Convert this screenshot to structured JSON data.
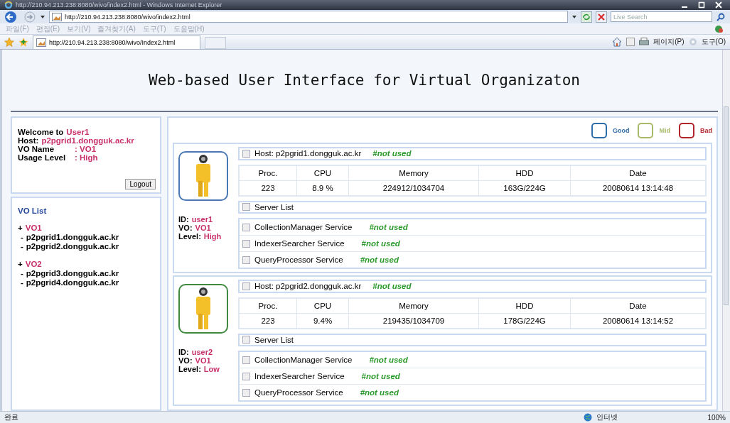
{
  "window": {
    "title": "http://210.94.213.238:8080/wivo/index2.html - Windows Internet Explorer"
  },
  "address_bar": {
    "url": "http://210.94.213.238:8080/wivo/index2.html",
    "search_placeholder": "Live Search"
  },
  "menu": [
    "파일(F)",
    "편집(E)",
    "보기(V)",
    "즐겨찾기(A)",
    "도구(T)",
    "도움말(H)"
  ],
  "tab": {
    "label": "http://210.94.213.238:8080/wivo/Index2.html"
  },
  "command_bar": [
    "페이지(P)",
    "도구(O)"
  ],
  "page": {
    "heading": "Web-based User Interface for Virtual Organizaton",
    "user_panel": {
      "rows": [
        {
          "label": "Welcome to",
          "value": "User1"
        },
        {
          "label": "Host:",
          "value": "p2pgrid1.dongguk.ac.kr"
        },
        {
          "label": "VO Name",
          "value": ": VO1"
        },
        {
          "label": "Usage Level",
          "value": ": High"
        }
      ],
      "logout": "Logout"
    },
    "vo_list": {
      "title": "VO List",
      "groups": [
        {
          "marker": "+",
          "name": "VO1",
          "children": [
            {
              "marker": "-",
              "label": "p2pgrid1.dongguk.ac.kr"
            },
            {
              "marker": "-",
              "label": "p2pgrid2.dongguk.ac.kr"
            }
          ]
        },
        {
          "marker": "+",
          "name": "VO2",
          "children": [
            {
              "marker": "-",
              "label": "p2pgrid3.dongguk.ac.kr"
            },
            {
              "marker": "-",
              "label": "p2pgrid4.dongguk.ac.kr"
            }
          ]
        }
      ]
    },
    "legend": [
      {
        "label": "Good",
        "color": "#2f6ea8"
      },
      {
        "label": "Mid",
        "color": "#a9bb6a"
      },
      {
        "label": "Bad",
        "color": "#b0262c"
      }
    ],
    "hosts": [
      {
        "color": "#4a78b5",
        "info": [
          {
            "label": "ID:",
            "value": "user1"
          },
          {
            "label": "VO:",
            "value": "VO1"
          },
          {
            "label": "Level:",
            "value": "High"
          }
        ],
        "host": {
          "label": "Host: p2pgrid1.dongguk.ac.kr",
          "status": "#not used",
          "checked": false
        },
        "columns": [
          "Proc.",
          "CPU",
          "Memory",
          "HDD",
          "Date"
        ],
        "values": [
          "223",
          "8.9 %",
          "224912/1034704",
          "163G/224G",
          "20080614 13:14:48"
        ],
        "server_list": {
          "label": "Server List",
          "checked": false
        },
        "services": [
          {
            "name": "CollectionManager Service",
            "status": "#not used",
            "checked": false
          },
          {
            "name": "IndexerSearcher Service",
            "status": "#not used",
            "checked": false
          },
          {
            "name": "QueryProcessor Service",
            "status": "#not used",
            "checked": false
          }
        ]
      },
      {
        "color": "#3f8a3f",
        "info": [
          {
            "label": "ID:",
            "value": "user2"
          },
          {
            "label": "VO:",
            "value": "VO1"
          },
          {
            "label": "Level:",
            "value": "Low"
          }
        ],
        "host": {
          "label": "Host: p2pgrid2.dongguk.ac.kr",
          "status": "#not used",
          "checked": false
        },
        "columns": [
          "Proc.",
          "CPU",
          "Memory",
          "HDD",
          "Date"
        ],
        "values": [
          "223",
          "9.4%",
          "219435/1034709",
          "178G/224G",
          "20080614 13:14:52"
        ],
        "server_list": {
          "label": "Server List",
          "checked": false
        },
        "services": [
          {
            "name": "CollectionManager Service",
            "status": "#not used",
            "checked": false
          },
          {
            "name": "IndexerSearcher Service",
            "status": "#not used",
            "checked": false
          },
          {
            "name": "QueryProcessor Service",
            "status": "#not used",
            "checked": false
          }
        ]
      }
    ]
  },
  "status_bar": {
    "text": "완료",
    "zone": "인터넷",
    "zoom": "100%"
  }
}
